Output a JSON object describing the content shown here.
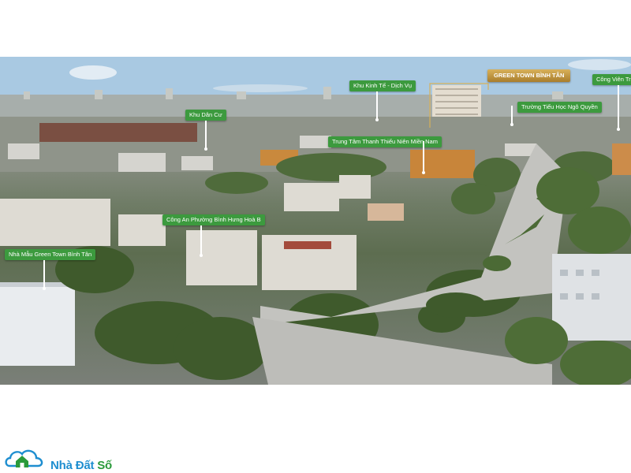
{
  "labels": {
    "green_town": "GREEN TOWN BÌNH TÂN",
    "cong_vien": "Công Viên Trung",
    "khu_kinh_te": "Khu Kinh Tế - Dịch Vụ",
    "khu_dan_cu": "Khu Dân Cư",
    "truong_tieu_hoc": "Trường Tiểu Học Ngô Quyền",
    "trung_tam_thanh_thieu_nien": "Trung Tâm Thanh Thiếu Niên Miền Nam",
    "cong_an": "Công An Phường Bình Hưng Hoà B",
    "nha_mau": "Nhà Mẫu Green Town Bình Tân"
  },
  "logo": {
    "name_part1": "Nhà Đất ",
    "name_part2": "Số"
  },
  "colors": {
    "callout_green": "#3c9a3e",
    "gold_tag": "#b88a36",
    "logo_blue": "#1e8ed0",
    "logo_green": "#2a9a3a"
  }
}
